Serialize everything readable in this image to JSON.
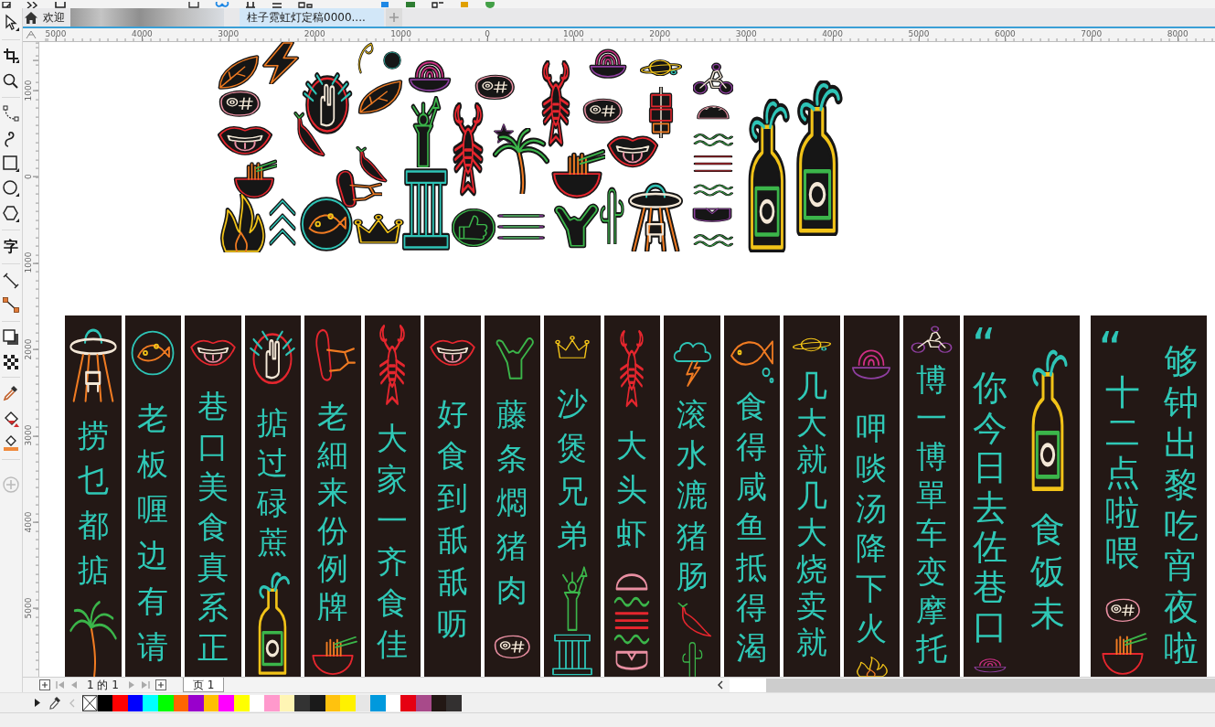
{
  "tabs": [
    {
      "label": "欢迎",
      "selected": false
    },
    {
      "label": "柱子霓虹灯定稿0000....",
      "selected": true
    }
  ],
  "rulers": {
    "horizontal": [
      "5000",
      "4000",
      "3000",
      "2000",
      "1000",
      "0",
      "1000",
      "2000",
      "3000",
      "4000",
      "5000",
      "6000",
      "7000",
      "8000"
    ],
    "vertical": [
      "1000",
      "0",
      "1000",
      "2000",
      "3000",
      "4000",
      "5000"
    ]
  },
  "toolbox": {
    "text_tool": "字"
  },
  "banners": [
    {
      "columns": [
        {
          "text": "捞乜都掂"
        }
      ]
    },
    {
      "columns": [
        {
          "text": "老板喱边有请"
        }
      ]
    },
    {
      "columns": [
        {
          "text": "巷口美食真系正"
        }
      ]
    },
    {
      "columns": [
        {
          "text": "掂过碌蔗"
        }
      ]
    },
    {
      "columns": [
        {
          "text": "老細来份例牌"
        }
      ]
    },
    {
      "columns": [
        {
          "text": "大家一齐食佳"
        }
      ]
    },
    {
      "columns": [
        {
          "text": "好食到舐舐呖"
        }
      ]
    },
    {
      "columns": [
        {
          "text": "藤条燜猪肉"
        }
      ]
    },
    {
      "columns": [
        {
          "text": "沙煲兄弟"
        }
      ]
    },
    {
      "columns": [
        {
          "text": "大头虾"
        }
      ]
    },
    {
      "columns": [
        {
          "text": "滚水漉猪肠"
        }
      ]
    },
    {
      "columns": [
        {
          "text": "食得咸鱼抵得渴"
        }
      ]
    },
    {
      "columns": [
        {
          "text": "几大就几大烧卖就"
        }
      ]
    },
    {
      "columns": [
        {
          "text": "呷啖汤降下火"
        }
      ]
    },
    {
      "columns": [
        {
          "text": "博一博單车变摩托"
        }
      ]
    },
    {
      "columns": [
        {
          "quote": "“",
          "text": "你今日去佐巷口"
        },
        {
          "text": "食饭未"
        }
      ]
    },
    {
      "columns": [
        {
          "quote": "“",
          "text": "十二点啦喂"
        },
        {
          "text": "够钟出黎吃宵夜啦"
        }
      ]
    }
  ],
  "page_nav": {
    "counter": "1 的 1",
    "page_tab": "页 1"
  },
  "palette": [
    {
      "kind": "none"
    },
    {
      "kind": "color",
      "color": "#000000"
    },
    {
      "kind": "color",
      "color": "#ff0000"
    },
    {
      "kind": "color",
      "color": "#0000ff"
    },
    {
      "kind": "color",
      "color": "#00ffff"
    },
    {
      "kind": "color",
      "color": "#00ff00"
    },
    {
      "kind": "color",
      "color": "#ff6600"
    },
    {
      "kind": "color",
      "color": "#9900cc"
    },
    {
      "kind": "color",
      "color": "#ffbf00"
    },
    {
      "kind": "color",
      "color": "#ff00ff"
    },
    {
      "kind": "color",
      "color": "#ffff00"
    },
    {
      "kind": "color",
      "color": "#ffffff"
    },
    {
      "kind": "color",
      "color": "#ff99cc"
    },
    {
      "kind": "color",
      "color": "#fff5b4"
    },
    {
      "kind": "color",
      "color": "#333333"
    },
    {
      "kind": "color",
      "color": "#1a1a1a"
    },
    {
      "kind": "color",
      "color": "#ffc20e"
    },
    {
      "kind": "color",
      "color": "#fff100"
    },
    {
      "kind": "color",
      "color": "#e6e6e6"
    },
    {
      "kind": "color",
      "color": "#0099dd"
    },
    {
      "kind": "color",
      "color": "#ffffff"
    },
    {
      "kind": "color",
      "color": "#e60012"
    },
    {
      "kind": "color",
      "color": "#a84a8a"
    },
    {
      "kind": "color",
      "color": "#231815"
    },
    {
      "kind": "color",
      "color": "#333030"
    }
  ]
}
